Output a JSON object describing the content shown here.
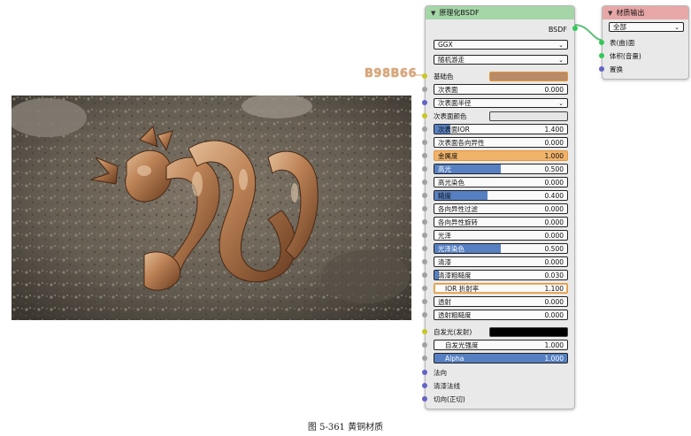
{
  "hex_label": "B98B66",
  "bsdf_node": {
    "title": "原理化BSDF",
    "output": "BSDF",
    "distribution": "GGX",
    "subsurface_method": "随机游走",
    "base_color_label": "基础色",
    "base_color": "#b98b66",
    "subsurface_radius_label": "次表面半径",
    "subsurface_color_label": "次表面颜色",
    "subsurface_color": "#e6e6e6",
    "emission_label": "自发光(发射)",
    "emission_color": "#000000",
    "sliders": [
      {
        "label": "次表面",
        "value": "0.000",
        "fill": 0.0,
        "active": false
      },
      {
        "label": "次表面IOR",
        "value": "1.400",
        "fill": 0.12,
        "active": false
      },
      {
        "label": "次表面各向异性",
        "value": "0.000",
        "fill": 0.0,
        "active": false
      },
      {
        "label": "金属度",
        "value": "1.000",
        "fill": 1.0,
        "active": true
      },
      {
        "label": "高光",
        "value": "0.500",
        "fill": 0.5,
        "active": false
      },
      {
        "label": "高光染色",
        "value": "0.000",
        "fill": 0.0,
        "active": false
      },
      {
        "label": "糙度",
        "value": "0.400",
        "fill": 0.4,
        "active": false
      },
      {
        "label": "各向异性过滤",
        "value": "0.000",
        "fill": 0.0,
        "active": false
      },
      {
        "label": "各向异性旋转",
        "value": "0.000",
        "fill": 0.0,
        "active": false
      },
      {
        "label": "光泽",
        "value": "0.000",
        "fill": 0.0,
        "active": false
      },
      {
        "label": "光泽染色",
        "value": "0.500",
        "fill": 0.5,
        "active": false
      },
      {
        "label": "清漆",
        "value": "0.000",
        "fill": 0.0,
        "active": false
      },
      {
        "label": "清漆粗糙度",
        "value": "0.030",
        "fill": 0.03,
        "active": false
      },
      {
        "label": "IOR 折射率",
        "value": "1.100",
        "fill": 0.0,
        "active": true
      },
      {
        "label": "透射",
        "value": "0.000",
        "fill": 0.0,
        "active": false
      },
      {
        "label": "透射粗糙度",
        "value": "0.000",
        "fill": 0.0,
        "active": false
      }
    ],
    "emission_strength": {
      "label": "自发光强度",
      "value": "1.000"
    },
    "alpha": {
      "label": "Alpha",
      "value": "1.000"
    },
    "bottom_inputs": [
      "法向",
      "清漆法线",
      "切向(正切)"
    ]
  },
  "output_node": {
    "title": "材质输出",
    "target": "全部",
    "inputs": [
      "表(曲)面",
      "体积(音量)",
      "置换"
    ]
  },
  "caption": "图 5-361 黄铜材质"
}
